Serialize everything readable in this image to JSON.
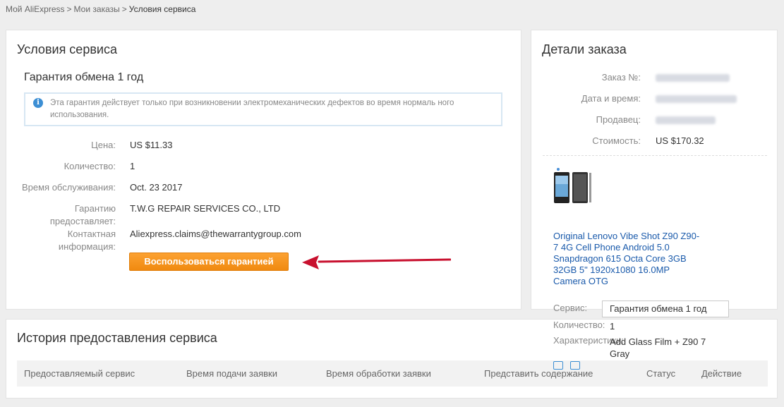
{
  "breadcrumb": {
    "items": [
      "Мой AliExpress",
      "Мои заказы"
    ],
    "separator": ">",
    "current": "Условия сервиса"
  },
  "service": {
    "title": "Условия сервиса",
    "warranty_title": "Гарантия обмена 1 год",
    "info_text": "Эта гарантия действует только при возникновении электромеханических дефектов во время нормаль ного использования.",
    "rows": [
      {
        "label": "Цена:",
        "value": "US $11.33"
      },
      {
        "label": "Количество:",
        "value": "1"
      },
      {
        "label": "Время обслуживания:",
        "value": "Oct. 23 2017"
      },
      {
        "label": "Гарантию предоставляет:",
        "value": "T.W.G REPAIR SERVICES CO., LTD"
      },
      {
        "label": "Контактная информация:",
        "value": "Aliexpress.claims@thewarrantygroup.com"
      }
    ],
    "button_label": "Воспользоваться гарантией"
  },
  "details": {
    "title": "Детали заказа",
    "rows": [
      {
        "label": "Заказ №:"
      },
      {
        "label": "Дата и время:"
      },
      {
        "label": "Продавец:"
      },
      {
        "label": "Стоимость:",
        "value": "US $170.32"
      }
    ],
    "product_title": "Original Lenovo Vibe Shot Z90 Z90-7 4G Cell Phone Android 5.0 Snapdragon 615 Octa Core 3GB 32GB 5\" 1920x1080 16.0MP Camera OTG",
    "service_label": "Сервис:",
    "service_value": "Гарантия обмена 1 год",
    "quantity_label": "Количество:",
    "quantity_value": "1",
    "characteristics_label": "Характеристики:",
    "characteristics_value": "Add Glass Film + Z90 7 Gray"
  },
  "history": {
    "title": "История предоставления сервиса",
    "columns": [
      "Предоставляемый сервис",
      "Время подачи заявки",
      "Время обработки заявки",
      "Представить содержание",
      "Статус",
      "Действие"
    ]
  },
  "colors": {
    "accent_orange": "#f39418",
    "link_blue": "#1a5aab",
    "arrow_red": "#c8102e",
    "info_blue": "#3d8fd4"
  }
}
